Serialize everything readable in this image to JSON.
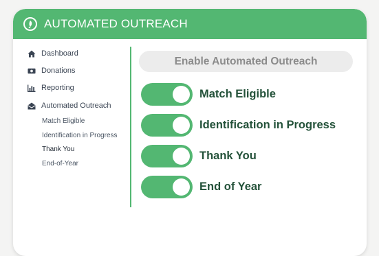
{
  "header": {
    "title": "AUTOMATED OUTREACH",
    "logo_icon": "leaf-logo-icon"
  },
  "sidebar": {
    "items": [
      {
        "label": "Dashboard",
        "icon": "home-icon"
      },
      {
        "label": "Donations",
        "icon": "money-icon"
      },
      {
        "label": "Reporting",
        "icon": "bar-chart-icon"
      },
      {
        "label": "Automated Outreach",
        "icon": "envelope-open-icon"
      }
    ],
    "subitems": [
      {
        "label": "Match Eligible"
      },
      {
        "label": "Identification in Progress"
      },
      {
        "label": "Thank You"
      },
      {
        "label": "End-of-Year"
      }
    ]
  },
  "main": {
    "enable_button_label": "Enable Automated Outreach",
    "toggles": [
      {
        "label": "Match Eligible",
        "on": true
      },
      {
        "label": "Identification in Progress",
        "on": true
      },
      {
        "label": "Thank You",
        "on": true
      },
      {
        "label": "End of Year",
        "on": true
      }
    ]
  },
  "colors": {
    "brand_green": "#53b772",
    "label_dark_green": "#24523a",
    "button_gray": "#ececec"
  }
}
